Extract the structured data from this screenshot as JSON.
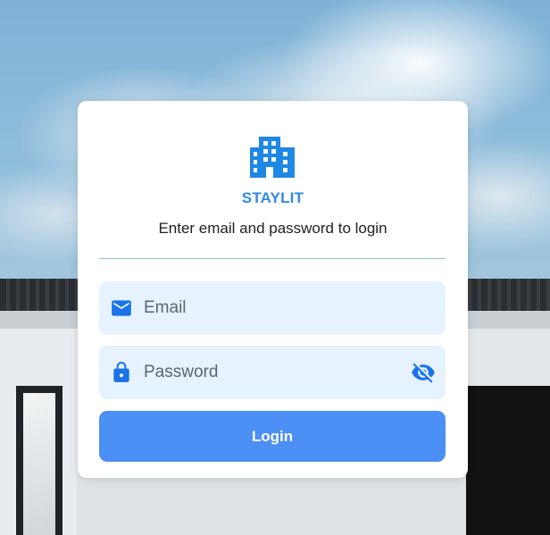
{
  "brand": {
    "name": "STAYLIT",
    "logo_icon": "building-icon",
    "color": "#2f8ae6"
  },
  "login_card": {
    "subtitle": "Enter email and password to login",
    "email": {
      "placeholder": "Email",
      "value": "",
      "icon": "mail-icon"
    },
    "password": {
      "placeholder": "Password",
      "value": "",
      "icon": "lock-icon",
      "visibility_icon": "eye-off-icon"
    },
    "login_button": {
      "label": "Login",
      "color": "#4c8ff5"
    }
  },
  "colors": {
    "field_background": "#e6f2fd",
    "icon_color": "#1a73e8",
    "divider": "#8fc0e6"
  }
}
